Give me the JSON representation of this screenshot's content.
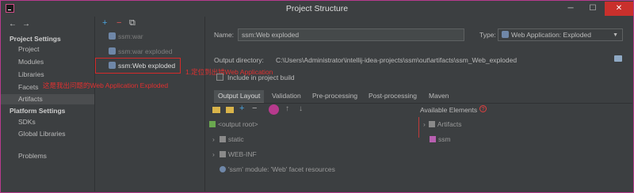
{
  "window": {
    "title": "Project Structure",
    "controls": {
      "minimize": "─",
      "maximize": "☐",
      "close": "✕"
    }
  },
  "nav": {
    "back": "←",
    "forward": "→",
    "project_settings": "Project Settings",
    "project_items": [
      "Project",
      "Modules",
      "Libraries",
      "Facets",
      "Artifacts"
    ],
    "platform_settings": "Platform Settings",
    "platform_items": [
      "SDKs",
      "Global Libraries"
    ],
    "problems": "Problems",
    "selected": "Artifacts"
  },
  "artifacts_toolbar": {
    "add": "+",
    "remove": "−",
    "copy": "⧉"
  },
  "artifacts": [
    {
      "label": "ssm:war",
      "active": false
    },
    {
      "label": "ssm:war exploded",
      "active": false
    },
    {
      "label": "ssm:Web exploded",
      "active": true
    }
  ],
  "annotations": {
    "locate": "1.定位到出错Web Application",
    "problem": "这是我出问题的Web Application Exploded"
  },
  "details": {
    "name_label": "Name:",
    "name_value": "ssm:Web exploded",
    "type_label": "Type:",
    "type_value": "Web Application: Exploded",
    "output_label": "Output directory:",
    "output_value": "C:\\Users\\Administrator\\intellij-idea-projects\\ssm\\out\\artifacts\\ssm_Web_exploded",
    "include_label": "Include in project build",
    "include_checked": false
  },
  "tabs": [
    "Output Layout",
    "Validation",
    "Pre-processing",
    "Post-processing",
    "Maven"
  ],
  "selected_tab": "Output Layout",
  "layout_toolbar": {
    "plus": "+",
    "minus": "−",
    "up": "↑",
    "down": "↓"
  },
  "output_tree": [
    {
      "label": "<output root>",
      "expanded": false
    },
    {
      "label": "static",
      "expanded": false
    },
    {
      "label": "WEB-INF",
      "expanded": false
    },
    {
      "label": "'ssm' module: 'Web' facet resources",
      "expanded": false
    }
  ],
  "available": {
    "header": "Available Elements",
    "help": "?",
    "items": [
      "Artifacts",
      "ssm"
    ]
  },
  "colors": {
    "accent": "#b73a8d",
    "annotation": "#e03030",
    "close": "#c9302c"
  }
}
